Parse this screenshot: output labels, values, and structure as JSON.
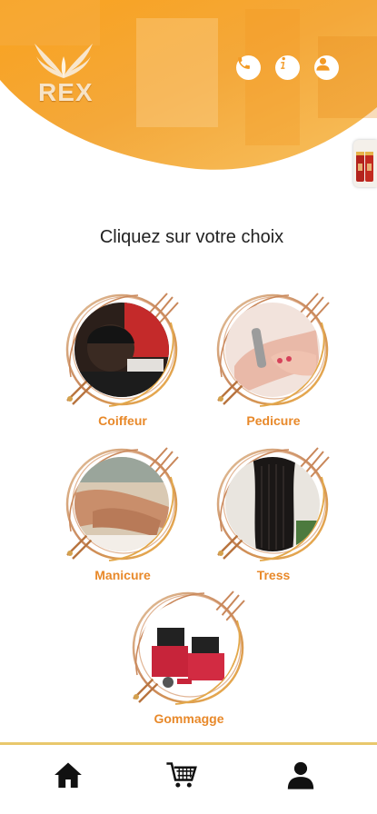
{
  "header": {
    "logo_text": "REX",
    "icons": [
      "phone-icon",
      "info-icon",
      "user-icon"
    ],
    "gradient": [
      "#f7b733",
      "#f28c1a"
    ]
  },
  "main": {
    "title": "Cliquez sur votre choix",
    "services": [
      {
        "label": "Coiffeur",
        "image": "barber-photo"
      },
      {
        "label": "Pedicure",
        "image": "nail-photo"
      },
      {
        "label": "Manicure",
        "image": "hand-massage-photo"
      },
      {
        "label": "Tress",
        "image": "braids-photo"
      },
      {
        "label": "Gommagge",
        "image": "makeup-case-photo"
      }
    ]
  },
  "nav": {
    "items": [
      "home-icon",
      "cart-icon",
      "profile-icon"
    ]
  },
  "colors": {
    "accent": "#e8892a",
    "divider": "#e9c86c"
  }
}
